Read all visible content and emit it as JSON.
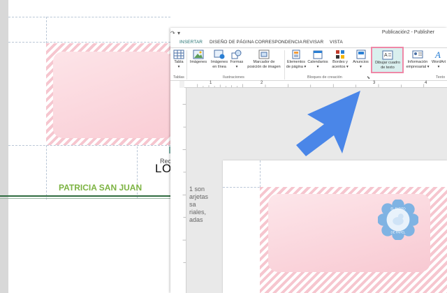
{
  "background_page": {
    "card_text_small": "Rec",
    "card_text_big": "LO",
    "name": "PATRICIA SAN JUAN",
    "fragments": [
      "1 son",
      "arjetas",
      "sa",
      "riales,",
      "adas"
    ]
  },
  "window": {
    "title": "Publicación2 - Publisher",
    "tabs": [
      {
        "label": "INSERTAR",
        "active": true
      },
      {
        "label": "DISEÑO DE PÁGINA",
        "active": false
      },
      {
        "label": "CORRESPONDENCIA",
        "active": false
      },
      {
        "label": "REVISAR",
        "active": false
      },
      {
        "label": "VISTA",
        "active": false
      }
    ],
    "ribbon": {
      "buttons": [
        {
          "label_1": "Tabla",
          "label_2": "▾",
          "icon": "table-icon"
        },
        {
          "label_1": "Imágenes",
          "label_2": "",
          "icon": "pictures-icon"
        },
        {
          "label_1": "Imágenes",
          "label_2": "en línea",
          "icon": "online-pictures-icon"
        },
        {
          "label_1": "Formas",
          "label_2": "▾",
          "icon": "shapes-icon"
        },
        {
          "label_1": "Marcador de",
          "label_2": "posición de imagen",
          "icon": "picture-placeholder-icon"
        },
        {
          "label_1": "Elementos",
          "label_2": "de página ▾",
          "icon": "page-parts-icon"
        },
        {
          "label_1": "Calendarios",
          "label_2": "▾",
          "icon": "calendar-icon"
        },
        {
          "label_1": "Bordes y",
          "label_2": "acentos ▾",
          "icon": "borders-icon"
        },
        {
          "label_1": "Anuncios",
          "label_2": "▾",
          "icon": "ads-icon"
        },
        {
          "label_1": "Dibujar cuadro",
          "label_2": "de texto",
          "icon": "draw-text-box-icon"
        },
        {
          "label_1": "Información",
          "label_2": "empresarial ▾",
          "icon": "business-info-icon"
        },
        {
          "label_1": "WordArt",
          "label_2": "▾",
          "icon": "wordart-icon"
        }
      ],
      "groups": {
        "tables": "Tablas",
        "illustrations": "Ilustraciones",
        "building_blocks": "Bloques de creación",
        "text": "Texto"
      }
    },
    "ruler_numbers": [
      "1",
      "2",
      "3",
      "4"
    ],
    "badge_text": {
      "top": "EL PATITO",
      "bottom": "DE PAPEL"
    }
  },
  "colors": {
    "highlight_pink": "#ef88a7",
    "accent_teal": "#1f6f6f",
    "arrow_blue": "#4a86e8",
    "name_green": "#7cb342"
  }
}
